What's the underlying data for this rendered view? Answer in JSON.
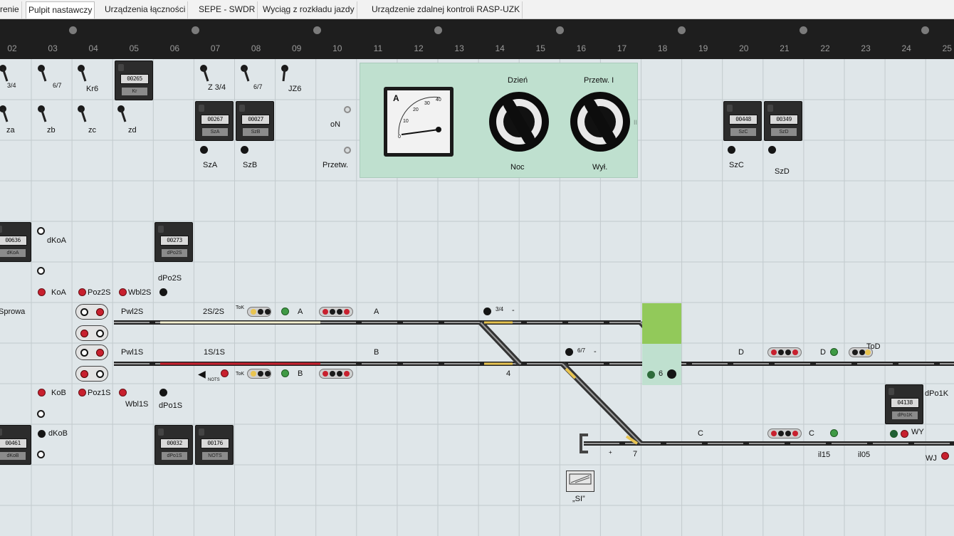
{
  "tabs": [
    {
      "label": "renie",
      "active": false
    },
    {
      "label": "Pulpit nastawczy",
      "active": true
    },
    {
      "label": "Urządzenia łączności",
      "active": false
    },
    {
      "label": "SEPE - SWDR",
      "active": false
    },
    {
      "label": "Wyciąg z rozkładu jazdy",
      "active": false
    },
    {
      "label": "Urządzenie zdalnej kontroli RASP-UZK",
      "active": false
    }
  ],
  "columns": [
    "02",
    "03",
    "04",
    "05",
    "06",
    "07",
    "08",
    "09",
    "10",
    "11",
    "12",
    "13",
    "14",
    "15",
    "16",
    "17",
    "18",
    "19",
    "20",
    "21",
    "22",
    "23",
    "24",
    "25"
  ],
  "levers": {
    "top": [
      "3/4",
      "6/7",
      "Kr6",
      "",
      "",
      "Z 3/4",
      "6/7",
      "JZ6"
    ],
    "second": [
      "za",
      "zb",
      "zc",
      "zd"
    ]
  },
  "counters": {
    "c1": {
      "digits": "00265",
      "plate": "Kr"
    },
    "szA": {
      "digits": "00267",
      "plate": "SzA"
    },
    "szB": {
      "digits": "00027",
      "plate": "SzB"
    },
    "szC": {
      "digits": "00448",
      "plate": "SzC"
    },
    "szD": {
      "digits": "00349",
      "plate": "SzD"
    },
    "dkoa": {
      "digits": "00636",
      "plate": "dKoA"
    },
    "dpo2s": {
      "digits": "00273",
      "plate": "dPo2S"
    },
    "dkob": {
      "digits": "00461",
      "plate": "dKoB"
    },
    "dpo1s": {
      "digits": "00032",
      "plate": "dPo1S"
    },
    "nots": {
      "digits": "00176",
      "plate": "NOTS"
    },
    "dpo1k": {
      "digits": "04138",
      "plate": "dPo1K"
    }
  },
  "labels": {
    "oN": "oN",
    "przetw": "Przetw.",
    "szA": "SzA",
    "szB": "SzB",
    "szC": "SzC",
    "szD": "SzD",
    "dKoA": "dKoA",
    "KoA": "KoA",
    "Poz2S": "Poz2S",
    "Wbl2S": "Wbl2S",
    "dPo2S": "dPo2S",
    "sprowa": "Sprowa",
    "Pwl2S": "Pwl2S",
    "track2S": "2S/2S",
    "sigA": "A",
    "trackA": "A",
    "sw34": "3/4",
    "Pwl1S": "Pwl1S",
    "track1S": "1S/1S",
    "trackB": "B",
    "sw67": "6/7",
    "trackD": "D",
    "sigD": "D",
    "ToD": "ToD",
    "sigB": "B",
    "NOTS": "NOTS",
    "four": "4",
    "six": "6",
    "KoB": "KoB",
    "Poz1S": "Poz1S",
    "Wbl1S": "Wbl1S",
    "dPo1S": "dPo1S",
    "dKoB": "dKoB",
    "dPo1K": "dPo1K",
    "trackC": "C",
    "sigC": "C",
    "WY": "WY",
    "WJ": "WJ",
    "seven": "7",
    "il15": "il15",
    "il05": "il05",
    "SI": "„SI”",
    "Tok1": "ToK",
    "Tok2": "ToK"
  },
  "panel": {
    "meter_unit": "A",
    "meter_scale": [
      "0",
      "10",
      "20",
      "30",
      "40"
    ],
    "knob1_top": "Dzień",
    "knob1_bottom": "Noc",
    "knob2_top": "Przetw. I",
    "knob2_bottom": "Wył.",
    "side_mark": "II"
  }
}
